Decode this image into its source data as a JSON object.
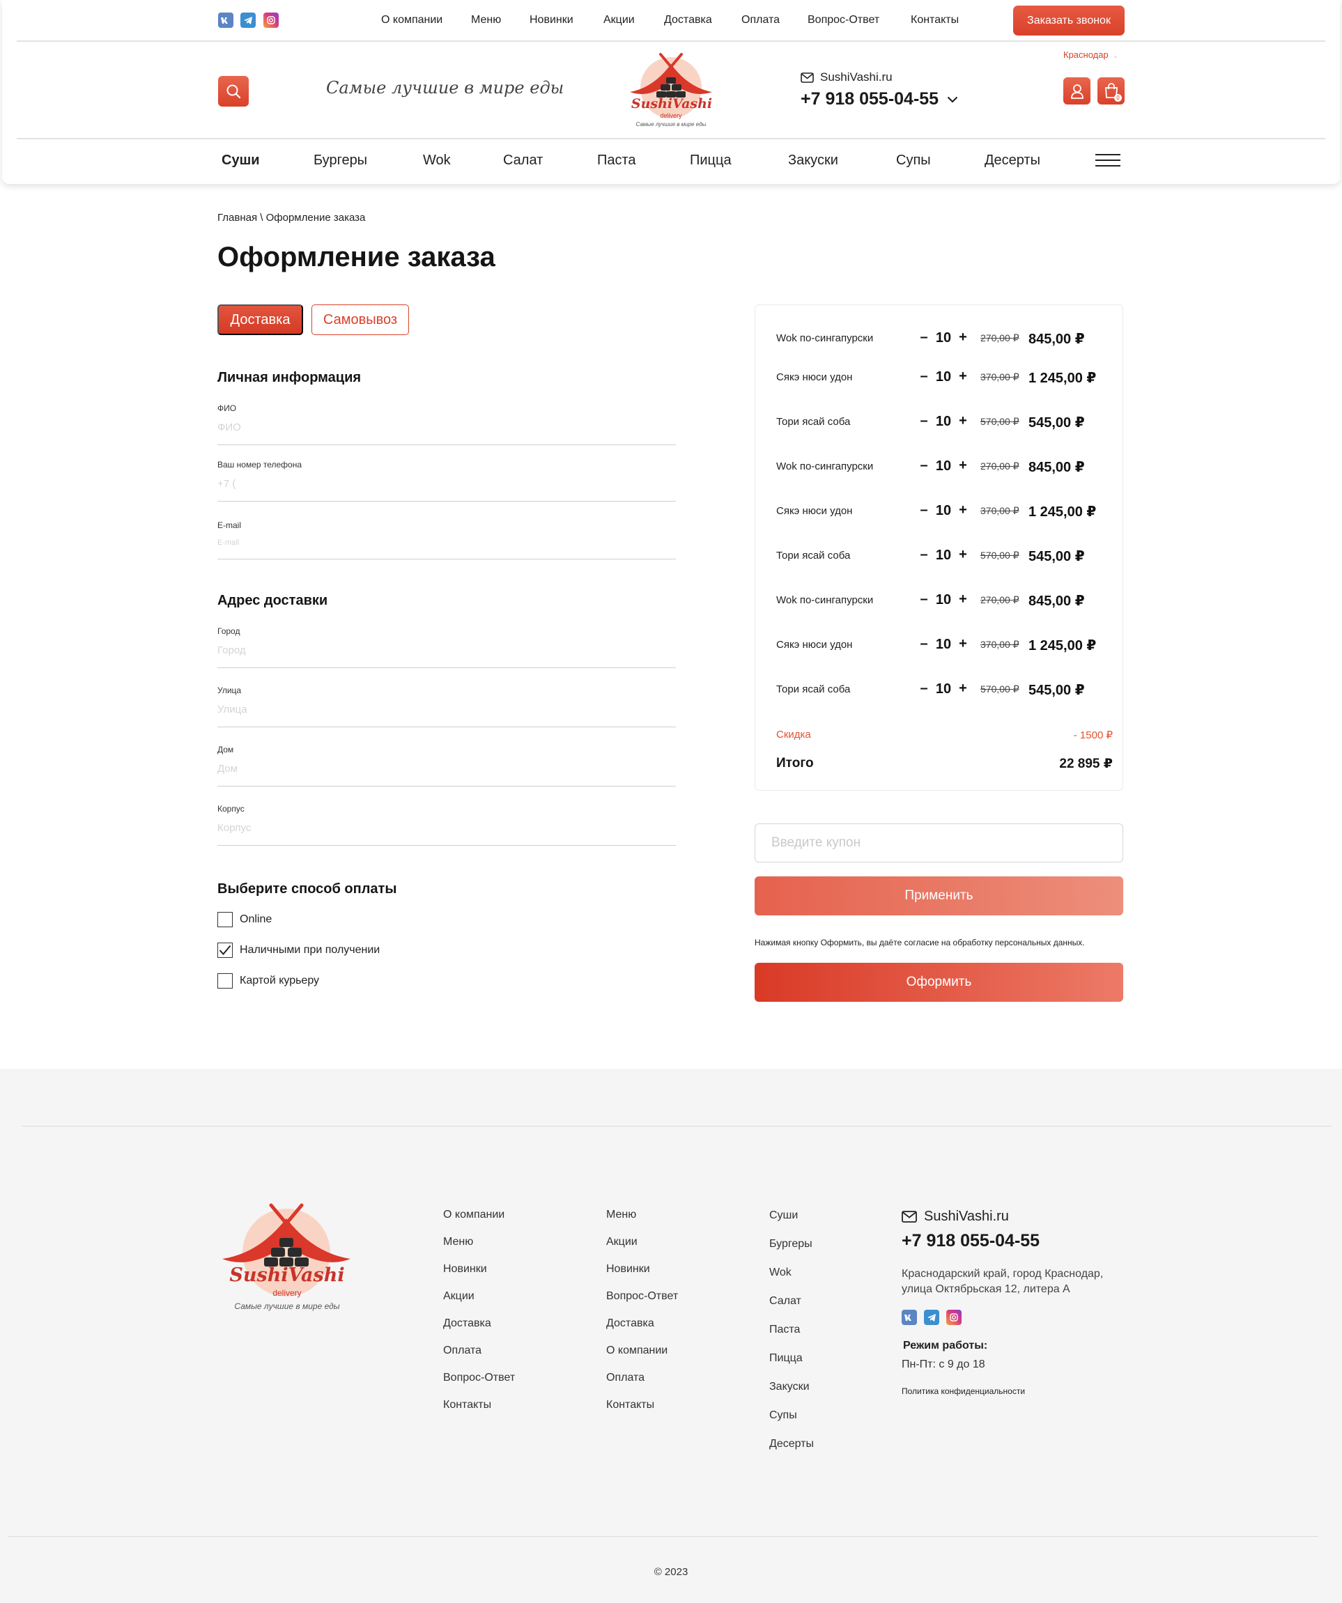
{
  "social": [
    "vk-icon",
    "telegram-icon",
    "instagram-icon"
  ],
  "top_nav": [
    "О компании",
    "Меню",
    "Новинки",
    "Акции",
    "Доставка",
    "Оплата",
    "Вопрос-Ответ",
    "Контакты"
  ],
  "call_button": "Заказать звонок",
  "city": "Краснодар",
  "slogan": "Самые лучшие в мире еды",
  "logo": {
    "name": "SushiVashi",
    "sub": "delivery",
    "tagline": "Самые лучшие в мире еды"
  },
  "contact": {
    "site": "SushiVashi.ru",
    "phone": "+7 918 055-04-55"
  },
  "cart_count": "0",
  "categories": [
    "Суши",
    "Бургеры",
    "Wok",
    "Салат",
    "Паста",
    "Пицца",
    "Закуски",
    "Супы",
    "Десерты"
  ],
  "breadcrumb": "Главная \\ Оформление заказа",
  "page_title": "Оформление заказа",
  "delivery_tabs": {
    "delivery": "Доставка",
    "pickup": "Самовывоз"
  },
  "personal": {
    "title": "Личная информация",
    "fio_label": "ФИО",
    "fio_placeholder": "ФИО",
    "phone_label": "Ваш номер телефона",
    "phone_placeholder": "+7 (",
    "email_label": "E-mail",
    "email_placeholder": "E-mail"
  },
  "address": {
    "title": "Адрес доставки",
    "city_label": "Город",
    "city_placeholder": "Город",
    "street_label": "Улица",
    "street_placeholder": "Улица",
    "house_label": "Дом",
    "house_placeholder": "Дом",
    "building_label": "Корпус",
    "building_placeholder": "Корпус"
  },
  "payment": {
    "title": "Выберите способ оплаты",
    "options": [
      {
        "label": "Online",
        "checked": false
      },
      {
        "label": "Наличными при получении",
        "checked": true
      },
      {
        "label": "Картой курьеру",
        "checked": false
      }
    ]
  },
  "order": {
    "items": [
      {
        "name": "Wok по-сингапурски",
        "qty": "10",
        "old_price": "270,00 ₽",
        "price": "845,00 ₽"
      },
      {
        "name": "Сякэ нюси удон",
        "qty": "10",
        "old_price": "370,00 ₽",
        "price": "1 245,00 ₽"
      },
      {
        "name": "Тори ясай соба",
        "qty": "10",
        "old_price": "570,00 ₽",
        "price": "545,00 ₽"
      },
      {
        "name": "Wok по-сингапурски",
        "qty": "10",
        "old_price": "270,00 ₽",
        "price": "845,00 ₽"
      },
      {
        "name": "Сякэ нюси удон",
        "qty": "10",
        "old_price": "370,00 ₽",
        "price": "1 245,00 ₽"
      },
      {
        "name": "Тори ясай соба",
        "qty": "10",
        "old_price": "570,00 ₽",
        "price": "545,00 ₽"
      },
      {
        "name": "Wok по-сингапурски",
        "qty": "10",
        "old_price": "270,00 ₽",
        "price": "845,00 ₽"
      },
      {
        "name": "Сякэ нюси удон",
        "qty": "10",
        "old_price": "370,00 ₽",
        "price": "1 245,00 ₽"
      },
      {
        "name": "Тори ясай соба",
        "qty": "10",
        "old_price": "570,00 ₽",
        "price": "545,00 ₽"
      }
    ],
    "discount_label": "Скидка",
    "discount_value": "- 1500 ₽",
    "total_label": "Итого",
    "total_value": "22 895 ₽"
  },
  "coupon_placeholder": "Введите купон",
  "apply_button": "Применить",
  "consent_text": "Нажимая кнопку Оформить, вы даёте согласие на обработку персональных данных.",
  "submit_button": "Оформить",
  "footer": {
    "col1": [
      "О компании",
      "Меню",
      "Новинки",
      "Акции",
      "Доставка",
      "Оплата",
      "Вопрос-Ответ",
      "Контакты"
    ],
    "col2": [
      "Меню",
      "Акции",
      "Новинки",
      "Вопрос-Ответ",
      "Доставка",
      "О компании",
      "Оплата",
      "Контакты"
    ],
    "col3": [
      "Суши",
      "Бургеры",
      "Wok",
      "Салат",
      "Паста",
      "Пицца",
      "Закуски",
      "Супы",
      "Десерты"
    ],
    "site": "SushiVashi.ru",
    "phone": "+7 918 055-04-55",
    "address": "Краснодарский край, город Краснодар, улица Октябрьская 12, литера А",
    "hours_title": "Режим работы:",
    "hours": "Пн-Пт: с 9 до 18",
    "policy": "Политика конфиденциальности",
    "copyright": "© 2023"
  },
  "colors": {
    "accent": "#d9412a",
    "accent_light": "#ec8f7b",
    "footer_bg": "#f5f5f5"
  }
}
